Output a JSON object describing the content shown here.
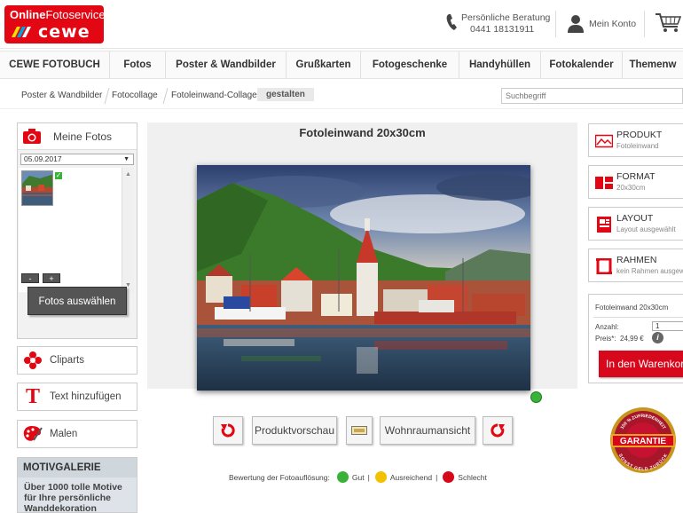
{
  "header": {
    "logo_top_bold": "Online",
    "logo_top_rest": "Fotoservice",
    "logo_brand": "cewe",
    "phone_line1": "Persönliche Beratung",
    "phone_line2": "0441 18131911",
    "account_label": "Mein Konto"
  },
  "nav": {
    "items": [
      "CEWE FOTOBUCH",
      "Fotos",
      "Poster & Wandbilder",
      "Grußkarten",
      "Fotogeschenke",
      "Handyhüllen",
      "Fotokalender",
      "Themenw"
    ]
  },
  "breadcrumb": {
    "items": [
      "Poster & Wandbilder",
      "Fotocollage",
      "Fotoleinwand-Collage",
      "gestalten"
    ]
  },
  "search": {
    "placeholder": "Suchbegriff"
  },
  "left": {
    "my_photos": "Meine Fotos",
    "date": "05.09.2017",
    "minus": "-",
    "plus": "+",
    "select_photos": "Fotos auswählen",
    "cliparts": "Cliparts",
    "add_text": "Text hinzufügen",
    "paint": "Malen",
    "gallery_title": "MOTIVGALERIE",
    "gallery_text": "Über 1000 tolle Motive für Ihre persönliche Wanddekoration"
  },
  "center": {
    "title": "Fotoleinwand 20x30cm",
    "preview": "Produktvorschau",
    "room_view": "Wohnraumansicht",
    "rating_label": "Bewertung der Fotoauflösung:",
    "rating_good": "Gut",
    "rating_ok": "Ausreichend",
    "rating_bad": "Schlecht",
    "sep": "|"
  },
  "right": {
    "product_title": "PRODUKT",
    "product_sub": "Fotoleinwand",
    "format_title": "FORMAT",
    "format_sub": "20x30cm",
    "layout_title": "LAYOUT",
    "layout_sub": "Layout ausgewählt",
    "frame_title": "RAHMEN",
    "frame_sub": "kein Rahmen ausgewählt",
    "order_name": "Fotoleinwand 20x30cm",
    "qty_label": "Anzahl:",
    "qty_value": "1",
    "price_label": "Preis*:",
    "price_value": "24,99 €",
    "info": "i",
    "cart_button": "In den Warenkorb",
    "guarantee_top": "100 % ZUFRIEDENHEIT",
    "guarantee_main": "GARANTIE",
    "guarantee_bottom": "SONST GELD ZURÜCK"
  },
  "colors": {
    "brand_red": "#e30613",
    "cart_red": "#d7081c",
    "good": "#3ab23a",
    "ok": "#f2c200",
    "bad": "#d7081c"
  }
}
